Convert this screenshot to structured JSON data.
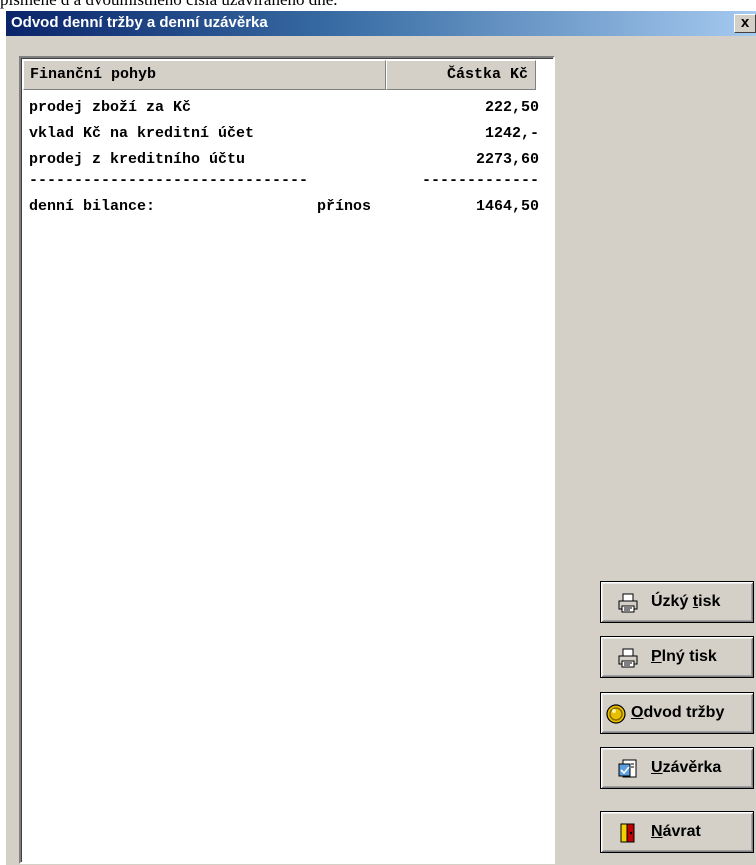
{
  "top_cut_text": "písmene d a dvoumístného čísla uzavíraného dne.",
  "window": {
    "title": "Odvod denní tržby a denní uzávěrka",
    "close_label": "x"
  },
  "table": {
    "columns": [
      "Finanční pohyb",
      "Částka Kč"
    ],
    "rows": [
      {
        "label": "prodej zboží za Kč",
        "note": "",
        "amount": "222,50"
      },
      {
        "label": "vklad Kč na kreditní účet",
        "note": "",
        "amount": "1242,-"
      },
      {
        "label": "prodej z kreditního účtu",
        "note": "",
        "amount": "2273,60"
      }
    ],
    "separator_left": "-------------------------------",
    "separator_right": "-------------",
    "total": {
      "label": "denní bilance:",
      "note": "přínos",
      "amount": "1464,50"
    }
  },
  "buttons": [
    {
      "pre": "Úzký ",
      "accel": "t",
      "post": "isk",
      "icon": "printer-icon"
    },
    {
      "pre": "",
      "accel": "P",
      "post": "lný tisk",
      "icon": "printer-icon"
    },
    {
      "pre": "",
      "accel": "O",
      "post": "dvod tržby",
      "icon": "coin-icon"
    },
    {
      "pre": "",
      "accel": "U",
      "post": "závěrka",
      "icon": "document-icon"
    },
    {
      "pre": "",
      "accel": "N",
      "post": "ávrat",
      "icon": "door-exit-icon"
    }
  ],
  "colors": {
    "titlebar_start": "#0a246a",
    "titlebar_end": "#a6caf0",
    "dialog_face": "#d4d0c8"
  }
}
